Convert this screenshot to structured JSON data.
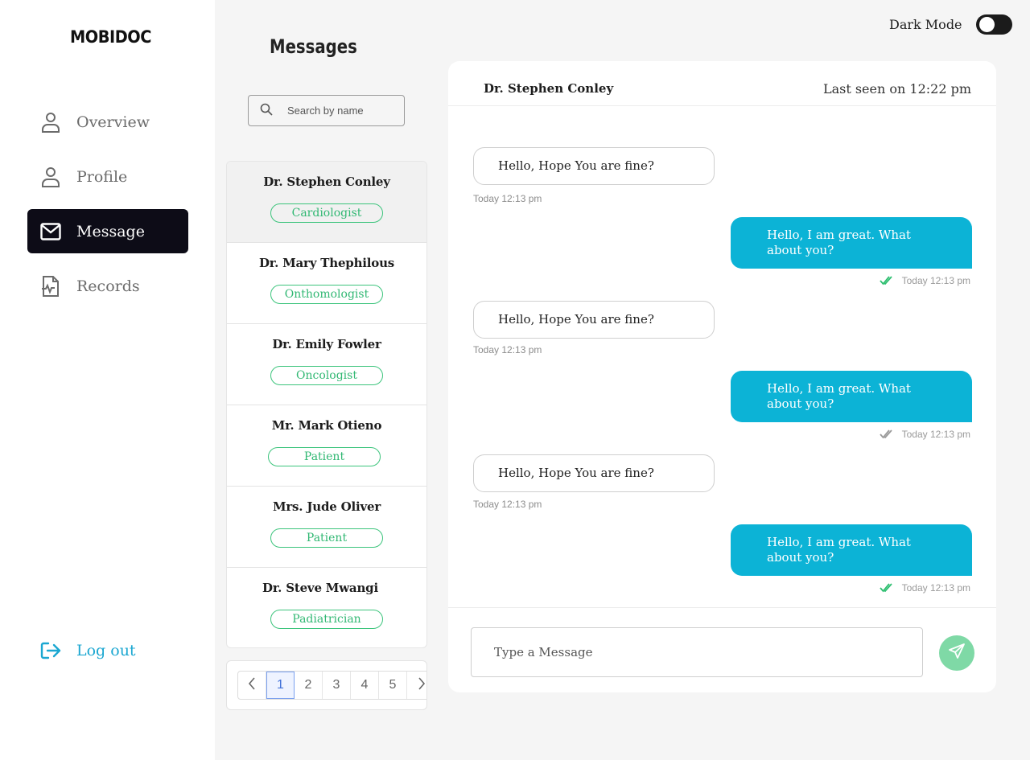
{
  "app": {
    "logo": "MOBIDOC"
  },
  "sidebar": {
    "items": [
      {
        "label": "Overview",
        "icon": "user-icon",
        "active": false
      },
      {
        "label": "Profile",
        "icon": "user-icon",
        "active": false
      },
      {
        "label": "Message",
        "icon": "mail-icon",
        "active": true
      },
      {
        "label": "Records",
        "icon": "file-chart-icon",
        "active": false
      }
    ],
    "logout_label": "Log out"
  },
  "messages": {
    "title": "Messages",
    "search_placeholder": "Search by name",
    "contacts": [
      {
        "name": "Dr. Stephen Conley",
        "role": "Cardiologist",
        "selected": true
      },
      {
        "name": "Dr. Mary Thephilous",
        "role": "Onthomologist",
        "selected": false
      },
      {
        "name": "Dr. Emily Fowler",
        "role": "Oncologist",
        "selected": false
      },
      {
        "name": "Mr. Mark Otieno",
        "role": "Patient",
        "selected": false
      },
      {
        "name": "Mrs. Jude Oliver",
        "role": "Patient",
        "selected": false
      },
      {
        "name": "Dr. Steve Mwangi",
        "role": "Padiatrician",
        "selected": false
      }
    ],
    "pagination": {
      "pages": [
        "1",
        "2",
        "3",
        "4",
        "5"
      ],
      "current": "1"
    }
  },
  "header": {
    "dark_mode_label": "Dark Mode",
    "dark_mode_on": false
  },
  "chat": {
    "contact_name": "Dr. Stephen Conley",
    "last_seen": "Last seen on 12:22 pm",
    "messages": [
      {
        "dir": "in",
        "text": "Hello, Hope You are fine?",
        "time": "Today 12:13 pm"
      },
      {
        "dir": "out",
        "text": "Hello, I am great. What about you?",
        "time": "Today 12:13 pm",
        "read": true
      },
      {
        "dir": "in",
        "text": "Hello, Hope You are fine?",
        "time": "Today 12:13 pm"
      },
      {
        "dir": "out",
        "text": "Hello, I am great. What about you?",
        "time": "Today 12:13 pm",
        "read": false
      },
      {
        "dir": "in",
        "text": "Hello, Hope You are fine?",
        "time": "Today 12:13 pm"
      },
      {
        "dir": "out",
        "text": "Hello, I am great. What about you?",
        "time": "Today 12:13 pm",
        "read": true
      }
    ],
    "input_placeholder": "Type a Message"
  },
  "colors": {
    "accent": "#0cb3d6",
    "tag_green": "#31b873",
    "send_button": "#7fd9a6",
    "read_tick": "#2fbf71",
    "unread_tick": "#9a9a9a",
    "active_nav": "#0d0c17",
    "logout": "#1ba7d1"
  }
}
